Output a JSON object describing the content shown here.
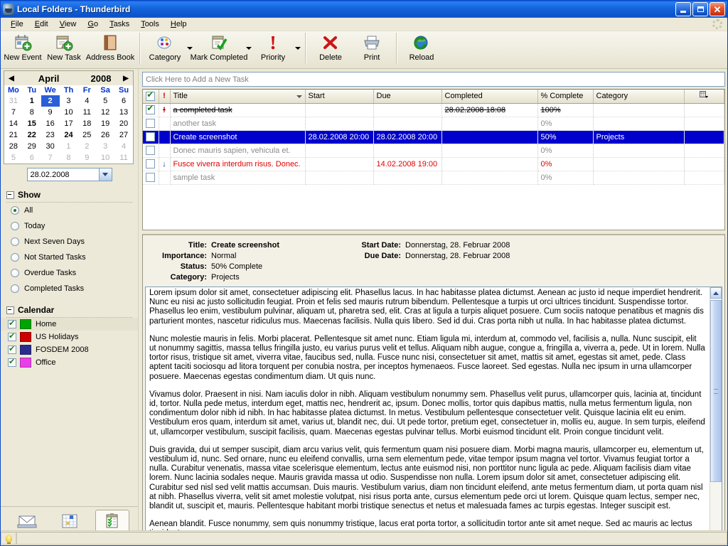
{
  "window": {
    "title": "Local Folders - Thunderbird",
    "icon": "thunderbird-icon",
    "minimize": "_",
    "maximize": "□",
    "close": "✕"
  },
  "menubar": {
    "items": [
      {
        "label": "File",
        "accel": "F"
      },
      {
        "label": "Edit",
        "accel": "E"
      },
      {
        "label": "View",
        "accel": "V"
      },
      {
        "label": "Go",
        "accel": "G"
      },
      {
        "label": "Tasks",
        "accel": "T"
      },
      {
        "label": "Tools",
        "accel": "T"
      },
      {
        "label": "Help",
        "accel": "H"
      }
    ]
  },
  "toolbar": {
    "buttons": [
      {
        "label": "New Event",
        "icon": "new-event-icon",
        "dropdown": false
      },
      {
        "label": "New Task",
        "icon": "new-task-icon",
        "dropdown": false
      },
      {
        "label": "Address Book",
        "icon": "address-book-icon",
        "dropdown": false
      },
      {
        "label": "Category",
        "icon": "category-icon",
        "dropdown": true
      },
      {
        "label": "Mark Completed",
        "icon": "mark-completed-icon",
        "dropdown": true
      },
      {
        "label": "Priority",
        "icon": "priority-icon",
        "dropdown": true
      },
      {
        "label": "Delete",
        "icon": "delete-icon",
        "dropdown": false
      },
      {
        "label": "Print",
        "icon": "print-icon",
        "dropdown": false
      },
      {
        "label": "Reload",
        "icon": "reload-icon",
        "dropdown": false
      }
    ]
  },
  "minimonth": {
    "month": "April",
    "year": "2008",
    "prev": "◀",
    "next": "▶",
    "weekday_headers": [
      "Mo",
      "Tu",
      "We",
      "Th",
      "Fr",
      "Sa",
      "Su"
    ],
    "weeks": [
      [
        {
          "d": "31",
          "t": "other"
        },
        {
          "d": "1",
          "t": "bold"
        },
        {
          "d": "2",
          "t": "sel"
        },
        {
          "d": "3",
          "t": ""
        },
        {
          "d": "4",
          "t": ""
        },
        {
          "d": "5",
          "t": ""
        },
        {
          "d": "6",
          "t": ""
        }
      ],
      [
        {
          "d": "7",
          "t": ""
        },
        {
          "d": "8",
          "t": ""
        },
        {
          "d": "9",
          "t": ""
        },
        {
          "d": "10",
          "t": ""
        },
        {
          "d": "11",
          "t": ""
        },
        {
          "d": "12",
          "t": ""
        },
        {
          "d": "13",
          "t": ""
        }
      ],
      [
        {
          "d": "14",
          "t": ""
        },
        {
          "d": "15",
          "t": "bold"
        },
        {
          "d": "16",
          "t": ""
        },
        {
          "d": "17",
          "t": ""
        },
        {
          "d": "18",
          "t": ""
        },
        {
          "d": "19",
          "t": ""
        },
        {
          "d": "20",
          "t": ""
        }
      ],
      [
        {
          "d": "21",
          "t": ""
        },
        {
          "d": "22",
          "t": "bold"
        },
        {
          "d": "23",
          "t": ""
        },
        {
          "d": "24",
          "t": "bold"
        },
        {
          "d": "25",
          "t": ""
        },
        {
          "d": "26",
          "t": ""
        },
        {
          "d": "27",
          "t": ""
        }
      ],
      [
        {
          "d": "28",
          "t": ""
        },
        {
          "d": "29",
          "t": ""
        },
        {
          "d": "30",
          "t": ""
        },
        {
          "d": "1",
          "t": "other"
        },
        {
          "d": "2",
          "t": "other"
        },
        {
          "d": "3",
          "t": "other"
        },
        {
          "d": "4",
          "t": "other"
        }
      ],
      [
        {
          "d": "5",
          "t": "other"
        },
        {
          "d": "6",
          "t": "other"
        },
        {
          "d": "7",
          "t": "other"
        },
        {
          "d": "8",
          "t": "other"
        },
        {
          "d": "9",
          "t": "other"
        },
        {
          "d": "10",
          "t": "other"
        },
        {
          "d": "11",
          "t": "other"
        }
      ]
    ],
    "date_field_value": "28.02.2008"
  },
  "show_section": {
    "title": "Show",
    "options": [
      {
        "label": "All",
        "selected": true
      },
      {
        "label": "Today",
        "selected": false
      },
      {
        "label": "Next Seven Days",
        "selected": false
      },
      {
        "label": "Not Started Tasks",
        "selected": false
      },
      {
        "label": "Overdue Tasks",
        "selected": false
      },
      {
        "label": "Completed Tasks",
        "selected": false
      }
    ]
  },
  "calendar_section": {
    "title": "Calendar",
    "calendars": [
      {
        "label": "Home",
        "color": "#00a400",
        "checked": true,
        "selected": true
      },
      {
        "label": "US Holidays",
        "color": "#cc0000",
        "checked": true,
        "selected": false
      },
      {
        "label": "FOSDEM 2008",
        "color": "#2b2b8f",
        "checked": true,
        "selected": false
      },
      {
        "label": "Office",
        "color": "#e83fe8",
        "checked": true,
        "selected": false
      }
    ]
  },
  "nav_buttons": [
    {
      "label": "Mail",
      "icon": "mail-icon",
      "active": false
    },
    {
      "label": "Calendar",
      "icon": "calendar-icon",
      "active": false
    },
    {
      "label": "Tasks",
      "icon": "tasks-icon",
      "active": true
    }
  ],
  "add_task": {
    "placeholder": "Click Here to Add a New Task"
  },
  "task_table": {
    "columns": [
      {
        "label": "",
        "key": "check",
        "icon": "checkmark-column-icon"
      },
      {
        "label": "",
        "key": "priority",
        "icon": "priority-column-icon"
      },
      {
        "label": "Title",
        "key": "title",
        "sorted": true
      },
      {
        "label": "Start",
        "key": "start"
      },
      {
        "label": "Due",
        "key": "due"
      },
      {
        "label": "Completed",
        "key": "completed"
      },
      {
        "label": "% Complete",
        "key": "percent"
      },
      {
        "label": "Category",
        "key": "category"
      },
      {
        "label": "",
        "key": "picker",
        "icon": "column-picker-icon"
      }
    ],
    "rows": [
      {
        "check": true,
        "priority": "high",
        "title": "a completed task",
        "start": "",
        "due": "",
        "completed": "28.02.2008 18:08",
        "percent": "100%",
        "category": "",
        "style": "done"
      },
      {
        "check": false,
        "priority": "",
        "title": "another task",
        "start": "",
        "due": "",
        "completed": "",
        "percent": "0%",
        "category": "",
        "style": "grey"
      },
      {
        "check": false,
        "priority": "",
        "title": "Create screenshot",
        "start": "28.02.2008 20:00",
        "due": "28.02.2008 20:00",
        "completed": "",
        "percent": "50%",
        "category": "Projects",
        "style": "selected"
      },
      {
        "check": false,
        "priority": "",
        "title": "Donec mauris sapien, vehicula et.",
        "start": "",
        "due": "",
        "completed": "",
        "percent": "0%",
        "category": "",
        "style": "grey"
      },
      {
        "check": false,
        "priority": "low",
        "title": "Fusce viverra interdum risus. Donec.",
        "start": "",
        "due": "14.02.2008 19:00",
        "completed": "",
        "percent": "0%",
        "category": "",
        "style": "red"
      },
      {
        "check": false,
        "priority": "",
        "title": "sample task",
        "start": "",
        "due": "",
        "completed": "",
        "percent": "0%",
        "category": "",
        "style": "grey"
      }
    ]
  },
  "details": {
    "labels": {
      "title": "Title:",
      "importance": "Importance:",
      "status": "Status:",
      "category": "Category:",
      "start_date": "Start Date:",
      "due_date": "Due Date:"
    },
    "values": {
      "title": "Create screenshot",
      "importance": "Normal",
      "status": "50% Complete",
      "category": "Projects",
      "start_date": "Donnerstag, 28. Februar 2008",
      "due_date": "Donnerstag, 28. Februar 2008"
    },
    "description": [
      "Lorem ipsum dolor sit amet, consectetuer adipiscing elit. Phasellus lacus. In hac habitasse platea dictumst. Aenean ac justo id neque imperdiet hendrerit. Nunc eu nisi ac justo sollicitudin feugiat. Proin et felis sed mauris rutrum bibendum. Pellentesque a turpis ut orci ultrices tincidunt. Suspendisse tortor. Phasellus leo enim, vestibulum pulvinar, aliquam ut, pharetra sed, elit. Cras at ligula a turpis aliquet posuere. Cum sociis natoque penatibus et magnis dis parturient montes, nascetur ridiculus mus. Maecenas facilisis. Nulla quis libero. Sed id dui. Cras porta nibh ut nulla. In hac habitasse platea dictumst.",
      "Nunc molestie mauris in felis. Morbi placerat. Pellentesque sit amet nunc. Etiam ligula mi, interdum at, commodo vel, facilisis a, nulla. Nunc suscipit, elit ut nonummy sagittis, massa tellus fringilla justo, eu varius purus velit et tellus. Aliquam nibh augue, congue a, fringilla a, viverra a, pede. Ut in lorem. Nulla tortor risus, tristique sit amet, viverra vitae, faucibus sed, nulla. Fusce nunc nisi, consectetuer sit amet, mattis sit amet, egestas sit amet, pede. Class aptent taciti sociosqu ad litora torquent per conubia nostra, per inceptos hymenaeos. Fusce laoreet. Sed egestas. Nulla nec ipsum in urna ullamcorper posuere. Maecenas egestas condimentum diam. Ut quis nunc.",
      "Vivamus dolor. Praesent in nisi. Nam iaculis dolor in nibh. Aliquam vestibulum nonummy sem. Phasellus velit purus, ullamcorper quis, lacinia at, tincidunt id, tortor. Nulla pede metus, interdum eget, mattis nec, hendrerit ac, ipsum. Donec mollis, tortor quis dapibus mattis, nulla metus fermentum ligula, non condimentum dolor nibh id nibh. In hac habitasse platea dictumst. In metus. Vestibulum pellentesque consectetuer velit. Quisque lacinia elit eu enim. Vestibulum eros quam, interdum sit amet, varius ut, blandit nec, dui. Ut pede tortor, pretium eget, consectetuer in, mollis eu, augue. In sem turpis, eleifend ut, ullamcorper vestibulum, suscipit facilisis, quam. Maecenas egestas pulvinar tellus. Morbi euismod tincidunt elit. Proin congue tincidunt velit.",
      "Duis gravida, dui ut semper suscipit, diam arcu varius velit, quis fermentum quam nisi posuere diam. Morbi magna mauris, ullamcorper eu, elementum ut, vestibulum id, nunc. Sed ornare, nunc eu eleifend convallis, urna sem elementum pede, vitae tempor ipsum magna vel tortor. Vivamus feugiat tortor a nulla. Curabitur venenatis, massa vitae scelerisque elementum, lectus ante euismod nisi, non porttitor nunc ligula ac pede. Aliquam facilisis diam vitae lorem. Nunc lacinia sodales neque. Mauris gravida massa ut odio. Suspendisse non nulla. Lorem ipsum dolor sit amet, consectetuer adipiscing elit. Curabitur sed nisl sed velit mattis accumsan. Duis mauris. Vestibulum varius, diam non tincidunt eleifend, ante metus fermentum diam, ut porta quam nisl at nibh. Phasellus viverra, velit sit amet molestie volutpat, nisi risus porta ante, cursus elementum pede orci ut lorem. Quisque quam lectus, semper nec, blandit ut, suscipit et, mauris. Pellentesque habitant morbi tristique senectus et netus et malesuada fames ac turpis egestas. Integer suscipit est.",
      "Aenean blandit. Fusce nonummy, sem quis nonummy tristique, lacus erat porta tortor, a sollicitudin tortor ante sit amet neque. Sed ac mauris ac lectus tincidunt"
    ]
  },
  "statusbar": {
    "icon": "lightbulb-icon",
    "text": ""
  },
  "colors": {
    "titlebar_blue": "#1566e0",
    "selection_blue": "#0000cc",
    "chrome": "#ece9d8",
    "overdue_red": "#e00000"
  }
}
